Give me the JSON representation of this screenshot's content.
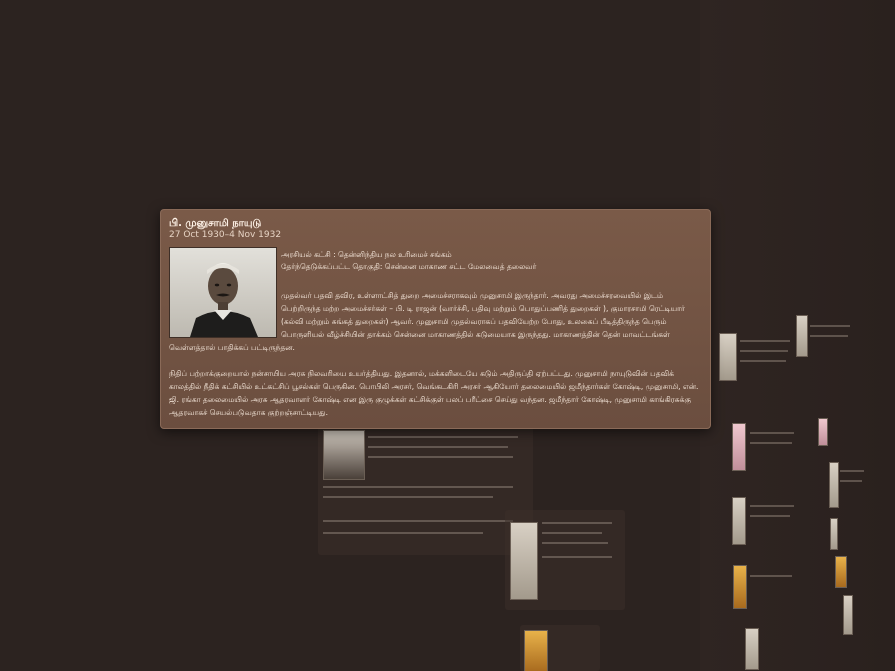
{
  "popup": {
    "name": "பி. முனுசாமி நாயுடு",
    "dates": "27 Oct 1930–4 Nov 1932",
    "party": "அரசியல் கட்சி : தென்னிந்திய நல உரிமைச் சங்கம்",
    "constituency": "தேர்ந்தெடுக்கப்பட்ட தொகுதி: சென்னை மாகாண சட்ட மேலவைத் தலைவர்",
    "paragraph1": "முதல்வர் பதவி தவிர, உள்ளாட்சித் துறை அமைச்சராகவும் முனுசாமி இருந்தார். அவரது அமைச்சரவையில் இடம் பெற்றிருந்த மற்ற அமைச்சர்கள் – பி. டி ராஜன் (வார்ச்சி, பதிவு மற்றும் பொதுப்பணித் துறைகள் ), குமாரசாமி ரெட்டியார் (கல்வி மற்றும் சுங்கத் துறைகள்) ஆவர். முனுசாமி முதல்வராகப் பதவியேற்ற போது, உலகைப் பீடித்திருந்த பெரும் பொருளியல் வீழ்ச்சியின் தாக்கம் சென்னை மாகாணத்தில் கடுமையாக இருந்தது. மாகாணத்தின் தென் மாவட்டங்கள்",
    "paragraph1_tail": "வெள்ளத்தால் பாதிக்கப் பட்டிருந்தன.",
    "paragraph2": "நிதிப் பற்றாக்குறையால் நன்சாயிய அரசு நிலவரியை உயர்த்தியது. இதனால், மக்களிடையே கடும் அதிருப்தி ஏற்பட்டது. முனுசாமி நாயுடுவின் பதவிக் காலத்தில் நீதிக் கட்சியில் உட்கட்சிப் பூசல்கள் பெருகின. பொபிலி அரசர், வெங்கடகிரி அரசர் ஆகியோர் தலைமையில் ஜமீந்தார்கள் கோஷ்டி, முனுசாமி, என். ஜி. ரங்கா தலைமையில் அரசு ஆதரவாளர் கோஷ்டி என இரு குழுக்கள் கட்சிக்குள் பலப் பரீட்சை செய்து வந்தன. ஜமீந்தார் கோஷ்டி, முனுசாமி காங்கிரசுக்கு ஆதரவாகச் செயல்படுவதாக குற்றஞ்சாட்டியது."
  },
  "colors": {
    "background": "#2c2320",
    "card": "#7a5a48",
    "corner": "#000000"
  }
}
